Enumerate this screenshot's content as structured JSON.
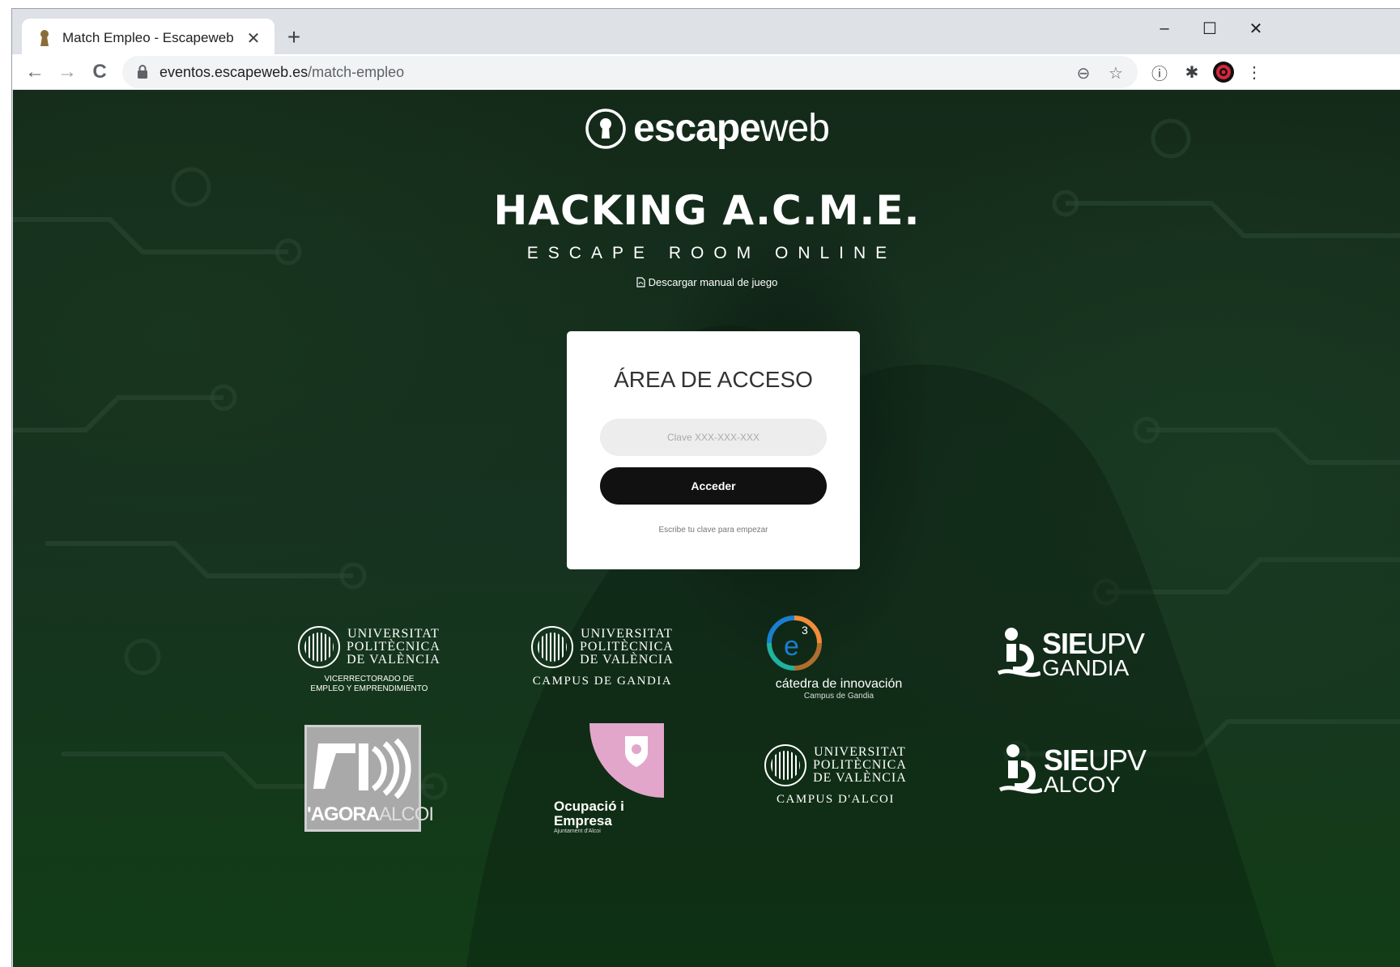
{
  "browser": {
    "tab_title": "Match Empleo - Escapeweb",
    "tab_close": "✕",
    "new_tab": "+",
    "url_domain": "eventos.escapeweb.es",
    "url_path": "/match-empleo",
    "window_minimize": "–",
    "window_maximize": "☐",
    "window_close": "✕"
  },
  "page": {
    "logo_bold": "escape",
    "logo_light": "web",
    "title": "HACKING A.C.M.E.",
    "subtitle": "ESCAPE ROOM ONLINE",
    "manual_link": "Descargar manual de juego"
  },
  "login": {
    "heading": "ÁREA DE ACCESO",
    "key_placeholder": "Clave XXX-XXX-XXX",
    "submit_label": "Acceder",
    "hint": "Escribe tu clave para empezar"
  },
  "sponsors": {
    "upv_vice": {
      "line1": "UNIVERSITAT",
      "line2": "POLITÈCNICA",
      "line3": "DE VALÈNCIA",
      "sub1": "VICERRECTORADO DE",
      "sub2": "EMPLEO Y EMPRENDIMIENTO"
    },
    "upv_gandia": {
      "line1": "UNIVERSITAT",
      "line2": "POLITÈCNICA",
      "line3": "DE VALÈNCIA",
      "sub": "CAMPUS DE GANDIA"
    },
    "catedra": {
      "name": "cátedra de innovación",
      "sub": "Campus de Gandia"
    },
    "sie_gandia": {
      "bold": "SIE",
      "light": "UPV",
      "place": "GANDIA"
    },
    "agora": {
      "bold": "'AGORA",
      "light": "ALCOI"
    },
    "ocupacio": {
      "line1": "Ocupació i",
      "line2": "Empresa",
      "sub": "Ajuntament d'Alcoi"
    },
    "upv_alcoi": {
      "line1": "UNIVERSITAT",
      "line2": "POLITÈCNICA",
      "line3": "DE VALÈNCIA",
      "sub": "CAMPUS D'ALCOI"
    },
    "sie_alcoy": {
      "bold": "SIE",
      "light": "UPV",
      "place": "ALCOY"
    }
  },
  "icons": {
    "back": "←",
    "forward": "→",
    "reload": "C",
    "zoom": "⊖",
    "star": "☆",
    "info": "ⓘ",
    "extensions": "✱",
    "menu": "⋮"
  }
}
